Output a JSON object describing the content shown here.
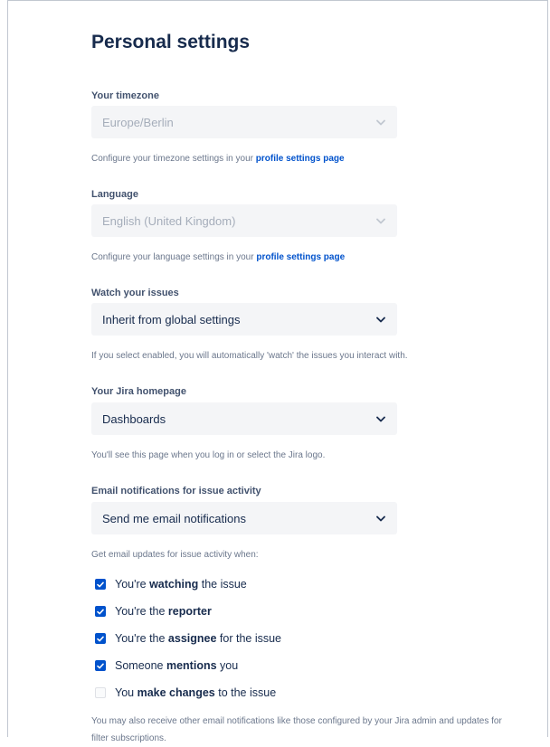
{
  "page": {
    "title": "Personal settings"
  },
  "timezone": {
    "label": "Your timezone",
    "value": "Europe/Berlin",
    "help_prefix": "Configure your timezone settings in your ",
    "help_link": "profile settings page"
  },
  "language": {
    "label": "Language",
    "value": "English (United Kingdom)",
    "help_prefix": "Configure your language settings in your ",
    "help_link": "profile settings page"
  },
  "watch": {
    "label": "Watch your issues",
    "value": "Inherit from global settings",
    "help": "If you select enabled, you will automatically 'watch' the issues you interact with."
  },
  "homepage": {
    "label": "Your Jira homepage",
    "value": "Dashboards",
    "help": "You'll see this page when you log in or select the Jira logo."
  },
  "email": {
    "label": "Email notifications for issue activity",
    "value": "Send me email notifications",
    "updates_intro": "Get email updates for issue activity when:",
    "options": [
      {
        "pre": "You're ",
        "bold": "watching",
        "post": " the issue",
        "checked": true
      },
      {
        "pre": "You're the ",
        "bold": "reporter",
        "post": "",
        "checked": true
      },
      {
        "pre": "You're the ",
        "bold": "assignee",
        "post": " for the issue",
        "checked": true
      },
      {
        "pre": "Someone ",
        "bold": "mentions",
        "post": " you",
        "checked": true
      },
      {
        "pre": "You ",
        "bold": "make changes",
        "post": " to the issue",
        "checked": false
      }
    ],
    "footer": "You may also receive other email notifications like those configured by your Jira admin and updates for filter subscriptions."
  },
  "icons": {
    "dropdown": "chevron-down-icon",
    "checkbox_checked": "checkmark-icon"
  },
  "colors": {
    "accent": "#0052cc",
    "field_bg": "#f4f5f7",
    "text": "#172b4d",
    "muted": "#6b778c"
  }
}
